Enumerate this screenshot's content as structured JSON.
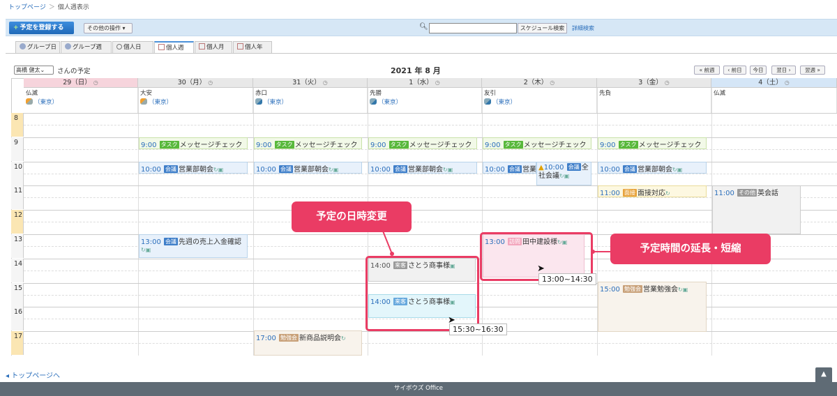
{
  "breadcrumb": {
    "home": "トップページ",
    "sep": "＞",
    "current": "個人週表示"
  },
  "toolbar": {
    "add_label": "予定を登録する",
    "other_label": "その他の操作",
    "search_button": "スケジュール検索",
    "advanced_search": "詳細検索"
  },
  "tabs": [
    "グループ日",
    "グループ週",
    "個人日",
    "個人週",
    "個人月",
    "個人年"
  ],
  "header": {
    "user": "高橋 健太",
    "user_suffix": "さんの予定",
    "title": "2021 年 8 月",
    "prev_week": "« 前週",
    "prev_day": "‹ 前日",
    "today": "今日",
    "next_day": "翌日 ›",
    "next_week": "翌週 »"
  },
  "days": [
    {
      "label": "29（日）",
      "rokuyo": "仏滅",
      "weather": "（東京）",
      "color": "#f6d4dc"
    },
    {
      "label": "30（月）",
      "rokuyo": "大安",
      "weather": "（東京）",
      "color": "#e8e8e8"
    },
    {
      "label": "31（火）",
      "rokuyo": "赤口",
      "weather": "（東京）",
      "color": "#e8e8e8"
    },
    {
      "label": "1（水）",
      "rokuyo": "先勝",
      "weather": "（東京）",
      "color": "#e8e8e8"
    },
    {
      "label": "2（木）",
      "rokuyo": "友引",
      "weather": "（東京）",
      "color": "#e8e8e8"
    },
    {
      "label": "3（金）",
      "rokuyo": "先負",
      "weather": "",
      "color": "#e8e8e8"
    },
    {
      "label": "4（土）",
      "rokuyo": "仏滅",
      "weather": "",
      "color": "#d5e6f7"
    }
  ],
  "hours": [
    "8",
    "9",
    "10",
    "11",
    "12",
    "13",
    "14",
    "15",
    "16",
    "17"
  ],
  "events": {
    "task_time": "9:00",
    "task_tag": "タスク",
    "task_title": "メッセージチェック",
    "meeting_time": "10:00",
    "meeting_tag": "会議",
    "meeting_title": "営業部朝会",
    "allhands_title": "全社会議",
    "interview_time": "11:00",
    "interview_tag": "面接",
    "interview_title": "面接対応",
    "english_time": "11:00",
    "english_tag": "その他",
    "english_title": "英会話",
    "sales_time": "13:00",
    "sales_tag": "会議",
    "sales_title": "先週の売上入金確認",
    "tanaka_time": "13:00",
    "tanaka_tag": "訪問",
    "tanaka_title": "田中建設様",
    "sato_time": "14:00",
    "sato_tag": "来客",
    "sato_title": "さとう商事様",
    "study_time": "15:00",
    "study_tag": "勉強会",
    "study_title": "営業勉強会",
    "product_time": "17:00",
    "product_tag": "勉強会",
    "product_title": "新商品説明会"
  },
  "annotations": {
    "move_label": "予定の日時変更",
    "resize_label": "予定時間の延長・短縮",
    "tooltip_resize": "13:00~14:30",
    "tooltip_move": "15:30~16:30"
  },
  "footer": {
    "back_link": "トップページへ",
    "brand": "サイボウズ Office",
    "scroll_top": "▲"
  }
}
